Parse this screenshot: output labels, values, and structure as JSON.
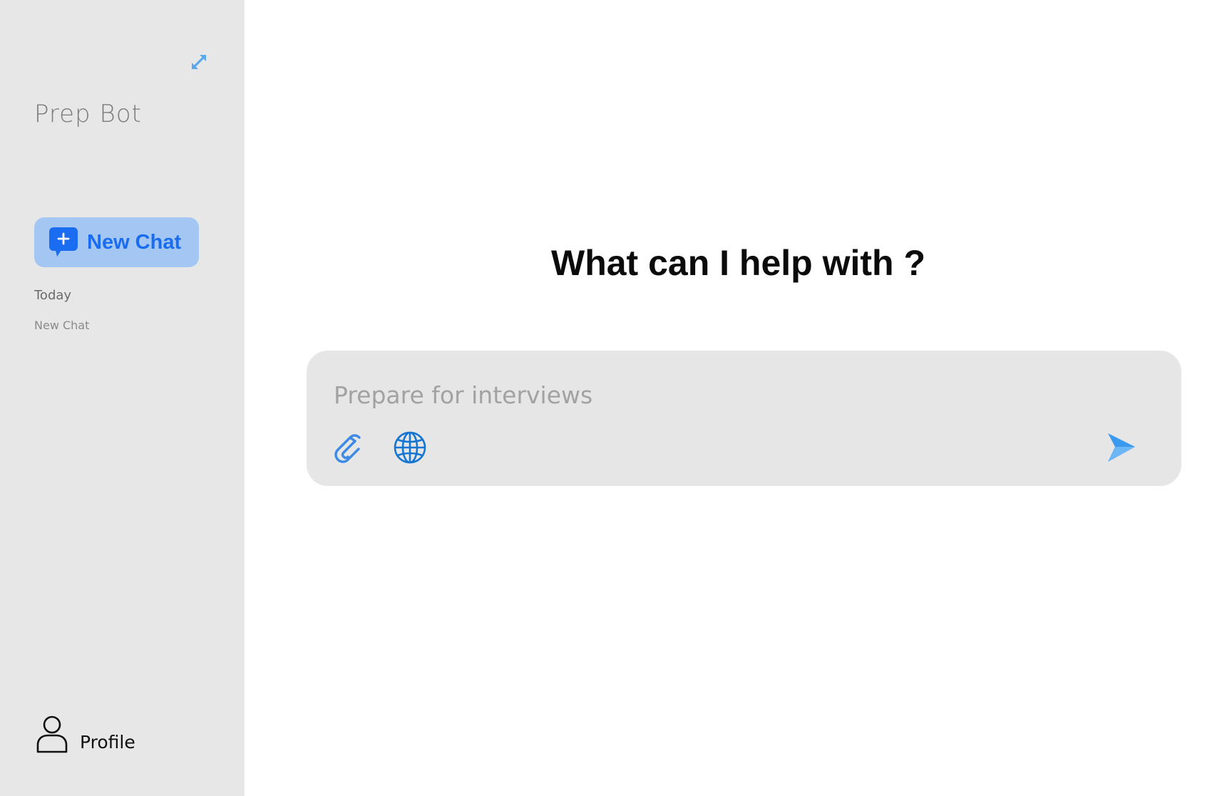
{
  "sidebar": {
    "expand_icon": "expand-arrows-icon",
    "brand": "Prep Bot",
    "new_chat": {
      "label": "New Chat",
      "icon": "chat-plus-icon"
    },
    "history": {
      "section_label": "Today",
      "items": [
        {
          "label": "New Chat"
        }
      ]
    },
    "profile": {
      "label": "Profile",
      "icon": "user-icon"
    }
  },
  "main": {
    "headline": "What can I help with ?",
    "composer": {
      "placeholder": "Prepare for interviews",
      "value": "",
      "attach_icon": "paperclip-icon",
      "web_icon": "globe-icon",
      "send_icon": "send-icon"
    }
  },
  "colors": {
    "sidebar_bg": "#e7e7e7",
    "accent": "#1a6cf0",
    "new_chat_bg": "#a4c6f3",
    "composer_bg": "#e6e6e6",
    "icon_blue": "#3d8ae6"
  }
}
